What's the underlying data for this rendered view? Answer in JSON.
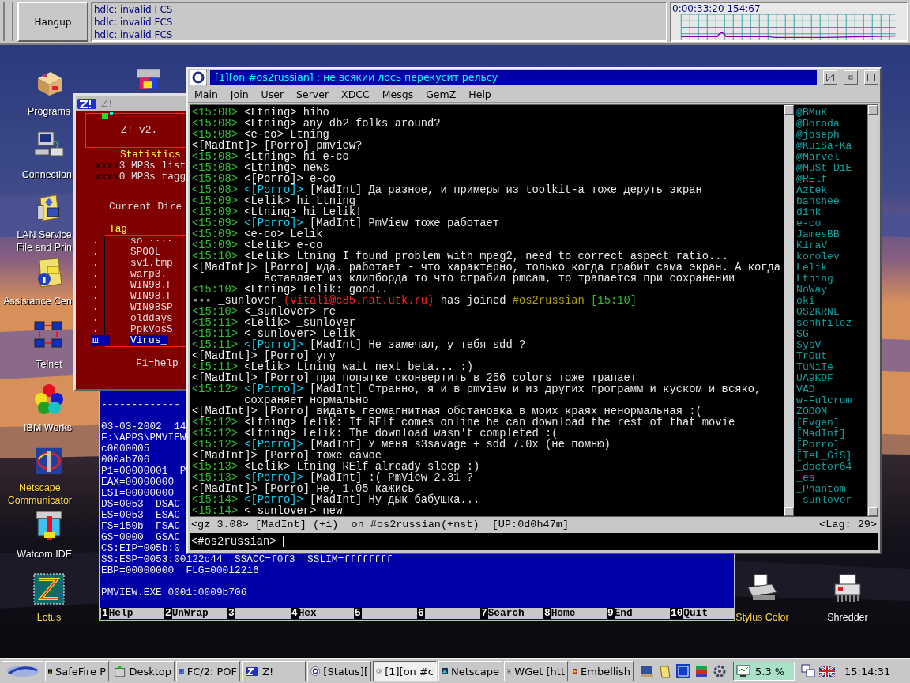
{
  "top_bar": {
    "button": "Hangup",
    "log": [
      "hdlc: invalid FCS",
      "hdlc: invalid FCS",
      "hdlc: invalid FCS"
    ],
    "graph_label": "0:00:33:20 154:67"
  },
  "desktop": {
    "left_icons": [
      {
        "kind": "package",
        "lines": [
          "Programs"
        ],
        "color": "#ffffff"
      },
      {
        "kind": "computer",
        "lines": [
          "Connection"
        ],
        "color": "#ffffff"
      },
      {
        "kind": "folder_net",
        "lines": [
          "LAN Service",
          "File and Prin"
        ],
        "color": "#ffffff"
      },
      {
        "kind": "folder_info",
        "lines": [
          "Assistance Cen"
        ],
        "color": "#ffffff"
      },
      {
        "kind": "network",
        "lines": [
          "Telnet"
        ],
        "color": "#ffffff"
      },
      {
        "kind": "balls",
        "lines": [
          "IBM Works"
        ],
        "color": "#ffffff"
      },
      {
        "kind": "ring",
        "lines": [
          "Netscape",
          "Communicator"
        ],
        "color": "#ffd840"
      },
      {
        "kind": "tool",
        "lines": [
          "Watcom IDE"
        ],
        "color": "#ffffff"
      },
      {
        "kind": "zigzag",
        "lines": [
          "Lotus"
        ],
        "color": "#ffd840"
      }
    ],
    "center_icons": [
      {
        "kind": "blocks"
      }
    ],
    "right_icons": [
      {
        "kind": "printer",
        "lines": [
          "Stylus Color"
        ],
        "color": "#ffd840"
      },
      {
        "kind": "shredder",
        "lines": [
          "Shredder"
        ],
        "color": "#ffffff"
      }
    ]
  },
  "z_window": {
    "title": "Z!",
    "version": "Z! v2.",
    "stats_title": "Statistics",
    "stats": [
      {
        "prefix": "xxxx",
        "text": "3 MP3s list"
      },
      {
        "prefix": "xxxx",
        "text": "0 MP3s tagg"
      }
    ],
    "dir_title": "Current Dire",
    "tag_title": "Tag",
    "files": [
      {
        "tag": ".",
        "name": "so ····",
        "selected": false
      },
      {
        "tag": ".",
        "name": "SPOOL",
        "selected": false
      },
      {
        "tag": ".",
        "name": "sv1.tmp",
        "selected": false
      },
      {
        "tag": ".",
        "name": "warp3.",
        "selected": false
      },
      {
        "tag": ".",
        "name": "WIN98.F",
        "selected": false
      },
      {
        "tag": ".",
        "name": "WIN98.F",
        "selected": false
      },
      {
        "tag": ".",
        "name": "WIN98SP",
        "selected": false
      },
      {
        "tag": ".",
        "name": "olddays",
        "selected": false
      },
      {
        "tag": ".",
        "name": "PpkVosS",
        "selected": false
      },
      {
        "tag": "ш",
        "name": "Virus_",
        "selected": true
      }
    ],
    "help": "F1=help"
  },
  "viewer_window": {
    "rule": "-------------",
    "lines": [
      "03-03-2002  14",
      "F:\\APPS\\PMVIEW",
      "c0000005",
      "000ab706",
      "P1=00000001  P",
      "EAX=00000000",
      "ESI=00000000",
      "DS=0053  DSAC",
      "ES=0053  ESAC",
      "FS=150b  FSAC",
      "GS=0000  GSAC",
      "CS:EIP=005b:0",
      "SS:ESP=0053:00122c44  SSACC=f0f3  SSLIM=ffffffff",
      "EBP=00000000  FLG=00012216"
    ],
    "footer": "PMVIEW.EXE 0001:0009b706",
    "keys": [
      {
        "num": "1",
        "label": "Help"
      },
      {
        "num": "2",
        "label": "UnWrap"
      },
      {
        "num": "3"
      },
      {
        "num": "4",
        "label": "Hex"
      },
      {
        "num": "5"
      },
      {
        "num": "6"
      },
      {
        "num": "7",
        "label": "Search"
      },
      {
        "num": "8",
        "label": "Home"
      },
      {
        "num": "9",
        "label": "End"
      },
      {
        "num": "10",
        "label": "Quit"
      }
    ]
  },
  "irc_window": {
    "title": "[1][on #os2russian] : не всякий лось перекусит рельсу",
    "menu": [
      "Main",
      "Join",
      "User",
      "Server",
      "XDCC",
      "Mesgs",
      "GemZ",
      "Help"
    ],
    "lines": [
      {
        "kind": "msg",
        "time": "<15:08>",
        "nick": "<Ltning>",
        "text": "hiho",
        "highlight": false
      },
      {
        "kind": "msg",
        "time": "<15:08>",
        "nick": "<Ltning>",
        "text": "any db2 folks around?",
        "highlight": false
      },
      {
        "kind": "msg",
        "time": "<15:08>",
        "nick": "<e-co>",
        "text": "Ltning",
        "highlight": false
      },
      {
        "kind": "own",
        "nick": "<[MadInt]>",
        "text": "[Porro] pmview?"
      },
      {
        "kind": "msg",
        "time": "<15:08>",
        "nick": "<Ltning>",
        "text": "hi e-co",
        "highlight": false
      },
      {
        "kind": "msg",
        "time": "<15:08>",
        "nick": "<Ltning>",
        "text": "news",
        "highlight": false
      },
      {
        "kind": "msg",
        "time": "<15:08>",
        "nick": "<[Porro]>",
        "text": "e-co",
        "highlight": false
      },
      {
        "kind": "msg",
        "time": "<15:08>",
        "nick": "<[Porro]>",
        "text": "[MadInt] Да разное, и примеры из toolkit-а тоже деруть экран",
        "highlight": true
      },
      {
        "kind": "msg",
        "time": "<15:09>",
        "nick": "<Lelik>",
        "text": "hi Ltning",
        "highlight": false
      },
      {
        "kind": "msg",
        "time": "<15:09>",
        "nick": "<Ltning>",
        "text": "hi Lelik!",
        "highlight": false
      },
      {
        "kind": "msg",
        "time": "<15:09>",
        "nick": "<[Porro]>",
        "text": "[MadInt] PmView тоже работает",
        "highlight": true
      },
      {
        "kind": "msg",
        "time": "<15:09>",
        "nick": "<e-co>",
        "text": "Lelik",
        "highlight": false
      },
      {
        "kind": "msg",
        "time": "<15:09>",
        "nick": "<Lelik>",
        "text": "e-co",
        "highlight": false
      },
      {
        "kind": "msg",
        "time": "<15:10>",
        "nick": "<Lelik>",
        "text": "Ltning I found problem with mpeg2, need to correct aspect ratio...",
        "highlight": false
      },
      {
        "kind": "own",
        "nick": "<[MadInt]>",
        "text": "[Porro] мда. работает - что характерно, только когда грабит сама экран. А когда вставляет из клипборда то что сграбил pmcam, то трапается при сохранении"
      },
      {
        "kind": "msg",
        "time": "<15:10>",
        "nick": "<Ltning>",
        "text": "Lelik: good..",
        "highlight": false
      },
      {
        "kind": "join",
        "marker": "▪▪▪",
        "nick": "_sunlover",
        "host": "(vitali@c85.nat.utk.ru)",
        "action": "has joined",
        "channel": "#os2russian",
        "time": "[15:10]"
      },
      {
        "kind": "msg",
        "time": "<15:10>",
        "nick": "<_sunlover>",
        "text": "re",
        "highlight": false
      },
      {
        "kind": "msg",
        "time": "<15:11>",
        "nick": "<Lelik>",
        "text": "_sunlover",
        "highlight": false
      },
      {
        "kind": "msg",
        "time": "<15:11>",
        "nick": "<_sunlover>",
        "text": "Lelik",
        "highlight": false
      },
      {
        "kind": "msg",
        "time": "<15:11>",
        "nick": "<[Porro]>",
        "text": "[MadInt] Не замечал, у тебя sdd ?",
        "highlight": true
      },
      {
        "kind": "own",
        "nick": "<[MadInt]>",
        "text": "[Porro] угу"
      },
      {
        "kind": "msg",
        "time": "<15:11>",
        "nick": "<Lelik>",
        "text": "Ltning wait next beta... :)",
        "highlight": false
      },
      {
        "kind": "own",
        "nick": "<[MadInt]>",
        "text": "[Porro] при попытке сконвертить в 256 colors тоже трапает"
      },
      {
        "kind": "msg",
        "time": "<15:12>",
        "nick": "<[Porro]>",
        "text": "[MadInt] Странно, я и в pmview и из других программ и куском и всяко, сохраняет нормально",
        "highlight": true
      },
      {
        "kind": "own",
        "nick": "<[MadInt]>",
        "text": "[Porro] видать геомагнитная обстановка в моих краях ненормальная :("
      },
      {
        "kind": "msg",
        "time": "<15:12>",
        "nick": "<Ltning>",
        "text": "Lelik: If RElf comes online he can download the rest of that movie",
        "highlight": false
      },
      {
        "kind": "msg",
        "time": "<15:12>",
        "nick": "<Ltning>",
        "text": "Lelik: The download wasn't completed :(",
        "highlight": false
      },
      {
        "kind": "msg",
        "time": "<15:12>",
        "nick": "<[Porro]>",
        "text": "[MadInt] У меня s3savage + sdd 7.0x (не помню)",
        "highlight": true
      },
      {
        "kind": "own",
        "nick": "<[MadInt]>",
        "text": "[Porro] тоже самое"
      },
      {
        "kind": "msg",
        "time": "<15:13>",
        "nick": "<Lelik>",
        "text": "Ltning RElf already sleep :)",
        "highlight": false
      },
      {
        "kind": "msg",
        "time": "<15:13>",
        "nick": "<[Porro]>",
        "text": "[MadInt] :( PmView 2.31 ?",
        "highlight": true
      },
      {
        "kind": "own",
        "nick": "<[MadInt]>",
        "text": "[Porro] не, 1.05 кажись"
      },
      {
        "kind": "msg",
        "time": "<15:14>",
        "nick": "<[Porro]>",
        "text": "[MadInt] Ну дык бабушка...",
        "highlight": true
      },
      {
        "kind": "msg",
        "time": "<15:14>",
        "nick": "<_sunlover>",
        "text": "new",
        "highlight": false
      }
    ],
    "nicks": [
      "@BMuK",
      "@Boroda",
      "@joseph",
      "@KuiSa-Ka",
      "@Marvel",
      "@MuSt_DiE",
      "@RElf",
      "Aztek",
      "banshee",
      "dink",
      "e-co",
      "JamesBB",
      "KiraV",
      "korolev",
      "Lelik",
      "Ltning",
      "NoWay",
      "oki",
      "OS2KRNL",
      "sehhfilez",
      "SG_",
      "SysV",
      "TrOut",
      "TuNiTe",
      "UA9KDF",
      "VAD",
      "w-Fulcrum",
      "ZOOOM",
      "[Evgen]",
      "[MadInt]",
      "[Porro]",
      "[TeL_GiS]",
      "_doctor64",
      "_es",
      "_Phantom",
      "_sunlover"
    ],
    "status": "<gz 3.08> [MadInt] (+i)  on #os2russian(+nst)  [UP:0d0h47m]",
    "lag": "<Lag: 29>",
    "prompt": "<#os2russian>"
  },
  "taskbar": {
    "items": [
      {
        "label": "SafeFire P",
        "selected": false
      },
      {
        "label": "Desktop",
        "selected": false
      },
      {
        "label": "FC/2: POF",
        "selected": false
      },
      {
        "label": "Z!",
        "selected": false
      },
      {
        "label": "[Status][",
        "selected": false
      },
      {
        "label": "[1][on #c",
        "selected": true
      },
      {
        "label": "Netscape",
        "selected": false
      },
      {
        "label": "WGet [htt",
        "selected": false
      },
      {
        "label": "Embellish",
        "selected": false
      }
    ],
    "cpu": "5.3 %",
    "clock": "15:14:31"
  }
}
